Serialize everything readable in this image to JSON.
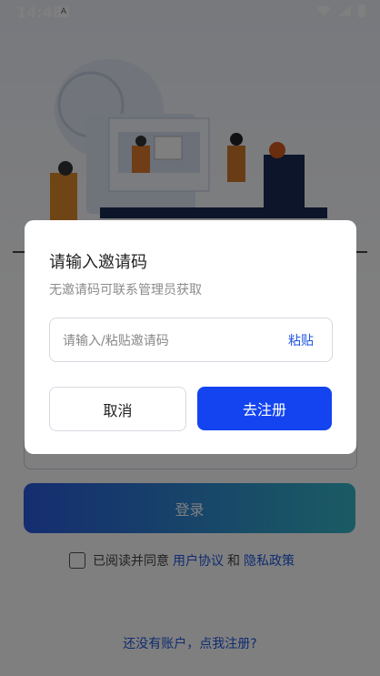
{
  "statusbar": {
    "time": "14:48",
    "a_icon": "A"
  },
  "login": {
    "login_button": "登录",
    "agree_prefix": "已阅读并同意",
    "user_agreement": "用户协议",
    "and": "和",
    "privacy_policy": "隐私政策",
    "register_prompt": "还没有账户，点我注册?"
  },
  "dialog": {
    "title": "请输入邀请码",
    "subtitle": "无邀请码可联系管理员获取",
    "input_placeholder": "请输入/粘贴邀请码",
    "paste_label": "粘贴",
    "cancel_label": "取消",
    "register_label": "去注册"
  },
  "colors": {
    "accent": "#1344f0",
    "link": "#1f56e0"
  },
  "icons": [
    "wifi-icon",
    "signal-icon",
    "battery-icon",
    "checkbox-icon"
  ]
}
